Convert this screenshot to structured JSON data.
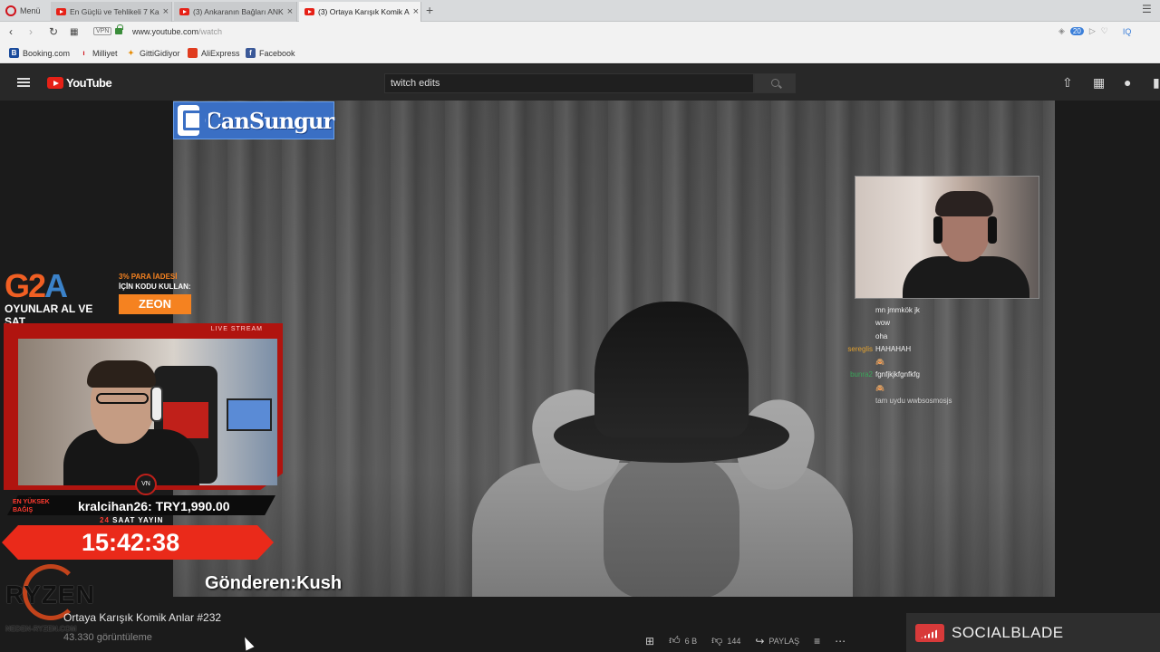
{
  "browser": {
    "menu_label": "Menü",
    "tabs": [
      {
        "title": "En Güçlü ve Tehlikeli 7 Ka"
      },
      {
        "title": "(3) Ankaranın Bağları ANK"
      },
      {
        "title": "(3) Ortaya Karışık Komik A"
      }
    ],
    "url_host": "www.youtube.com",
    "url_path": "/watch",
    "vpn_label": "VPN",
    "badge_count": "20",
    "bookmarks": [
      {
        "label": "Booking.com",
        "icon": "B",
        "color": "#1a4b9c"
      },
      {
        "label": "Milliyet",
        "icon": "M",
        "color": "#d0121b"
      },
      {
        "label": "GittiGidiyor",
        "icon": "G",
        "color": "#e68a00"
      },
      {
        "label": "AliExpress",
        "icon": "A",
        "color": "#e03c1f"
      },
      {
        "label": "Facebook",
        "icon": "f",
        "color": "#3b5998"
      }
    ]
  },
  "youtube": {
    "logo_text": "YouTube",
    "search_value": "twitch edits"
  },
  "video": {
    "twitch_channel": "CanSungur",
    "chat": [
      {
        "user": "",
        "msg": "mn jmmkök jk",
        "color": "#4b7bd6"
      },
      {
        "user": "",
        "msg": "wow",
        "color": "#d23b3b"
      },
      {
        "user": "",
        "msg": "oha",
        "color": "#7a5ad6"
      },
      {
        "user": "sereglis",
        "msg": "HAHAHAH",
        "color": "#e0a030"
      },
      {
        "user": "",
        "msg": "🙈",
        "color": "#b05ad6"
      },
      {
        "user": "bunra2",
        "msg": "fgnfjkjkfgnfkfg",
        "color": "#3aa65a"
      },
      {
        "user": "",
        "msg": "🙈",
        "color": "#4b7bd6"
      },
      {
        "user": "",
        "msg": "tam uydu wwbsosmosjs",
        "color": "#4b7bd6"
      }
    ],
    "sender": "Gönderen:Kush"
  },
  "overlay": {
    "g2a_logo": {
      "g": "G",
      "two": "2",
      "a": "A"
    },
    "g2a_sub": "OYUNLAR AL VE SAT",
    "promo_line1": "3% PARA İADESİ",
    "promo_line2": "İÇİN KODU KULLAN:",
    "promo_code": "ZEON",
    "live_label": "LIVE STREAM",
    "emblem": "VN",
    "top_label": "EN YÜKSEK BAĞIŞ",
    "top_donation": "kralcihan26: TRY1,990.00",
    "saat_num": "24",
    "saat_text": "SAAT YAYIN",
    "timer": "15:42:38",
    "ryzen": "RYZEN",
    "ryzen_sub": "NEDEN-RYZEN.COM"
  },
  "below": {
    "title": "Ortaya Karışık Komik Anlar #232",
    "views": "43.330 görüntüleme",
    "likes": "6 B",
    "dislikes": "144",
    "share": "PAYLAŞ",
    "socialblade": "SOCIALBLADE"
  }
}
